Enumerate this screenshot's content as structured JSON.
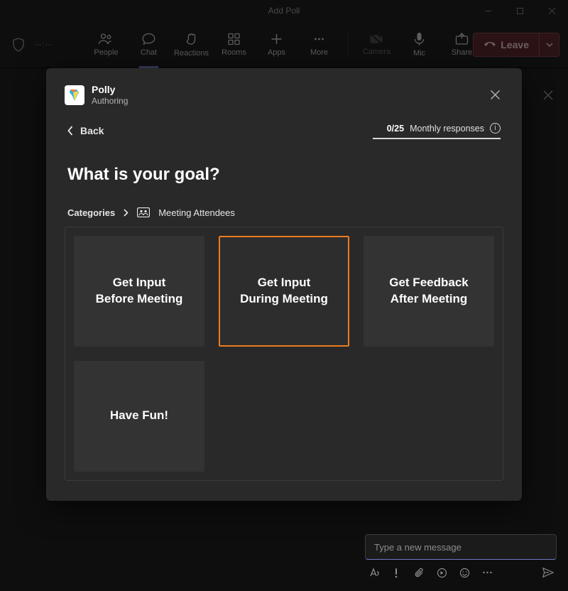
{
  "titlebar": {
    "title": "Add Poll"
  },
  "toolbar": {
    "time": "--:--",
    "items": [
      {
        "label": "People"
      },
      {
        "label": "Chat"
      },
      {
        "label": "Reactions"
      },
      {
        "label": "Rooms"
      },
      {
        "label": "Apps"
      },
      {
        "label": "More"
      },
      {
        "label": "Camera"
      },
      {
        "label": "Mic"
      },
      {
        "label": "Share"
      }
    ],
    "leave": "Leave"
  },
  "modal": {
    "app_name": "Polly",
    "app_subtitle": "Authoring",
    "back_label": "Back",
    "quota_count": "0/25",
    "quota_label": "Monthly responses",
    "heading": "What is your goal?",
    "crumb_root": "Categories",
    "crumb_leaf": "Meeting Attendees",
    "cards": [
      {
        "label": "Get Input\nBefore Meeting",
        "selected": false
      },
      {
        "label": "Get Input\nDuring Meeting",
        "selected": true
      },
      {
        "label": "Get Feedback\nAfter Meeting",
        "selected": false
      },
      {
        "label": "Have Fun!",
        "selected": false
      }
    ]
  },
  "compose": {
    "placeholder": "Type a new message"
  }
}
